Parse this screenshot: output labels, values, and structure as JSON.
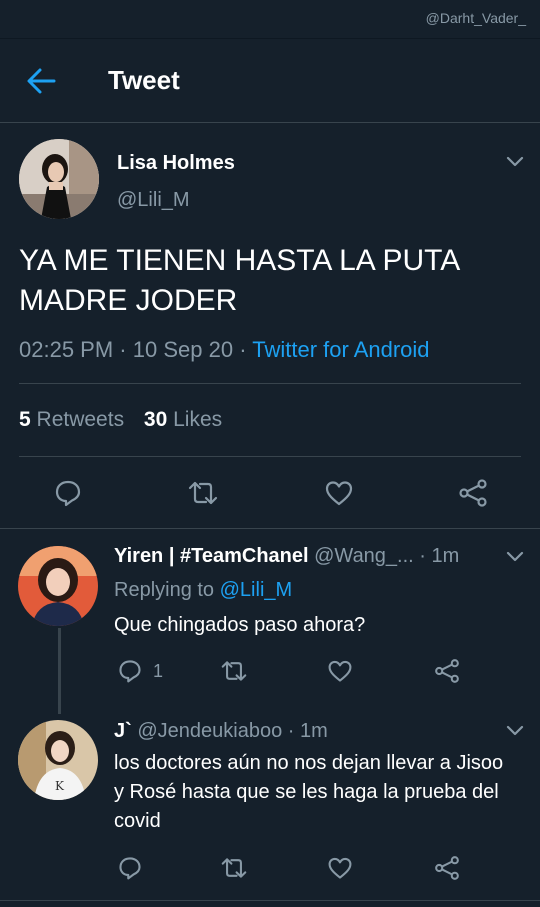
{
  "watermark": "@Darht_Vader_",
  "header": {
    "title": "Tweet"
  },
  "tweet": {
    "author_name": "Lisa Holmes",
    "author_handle": "@Lili_M",
    "text": "YA ME TIENEN HASTA LA PUTA MADRE JODER",
    "time": "02:25 PM",
    "date": "10 Sep 20",
    "source": "Twitter for Android",
    "retweets_count": "5",
    "retweets_label": "Retweets",
    "likes_count": "30",
    "likes_label": "Likes"
  },
  "replies": [
    {
      "name": "Yiren | #TeamChanel",
      "handle": "@Wang_...",
      "time": "1m",
      "replying_label": "Replying to",
      "replying_to": "@Lili_M",
      "text": "Que chingados paso ahora?",
      "reply_count": "1"
    },
    {
      "name": "J`",
      "handle": "@Jendeukiaboo",
      "time": "1m",
      "text": "los doctores aún no nos dejan llevar a Jisoo y Rosé hasta que se les haga la prueba del covid"
    }
  ],
  "icons": {
    "back": "arrow-left-icon",
    "reply": "speech-bubble-icon",
    "retweet": "retweet-icon",
    "like": "heart-icon",
    "share": "share-icon",
    "more": "chevron-down-icon"
  },
  "colors": {
    "background": "#15202b",
    "accent": "#1da1f2",
    "secondary_text": "#8899a6",
    "divider": "#38444d"
  }
}
